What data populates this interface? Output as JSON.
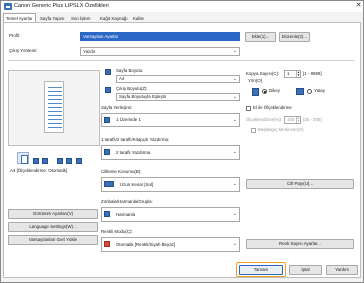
{
  "window": {
    "title": "Canon Generic Plus LIPSLX Özellikleri",
    "close_glyph": "✕"
  },
  "tabs": [
    {
      "label": "Temel Ayarlar"
    },
    {
      "label": "Sayfa Yapısı"
    },
    {
      "label": "Son İşlem"
    },
    {
      "label": "Kağıt Kaynağı"
    },
    {
      "label": "Kalite"
    }
  ],
  "profile": {
    "label": "Profil:",
    "value": "Varsayılan Ayarlar",
    "add_button": "Ekle(1)...",
    "edit_button": "Düzenle(2)..."
  },
  "output_method": {
    "label": "Çıkış Yöntemi:",
    "value": "Yazdır"
  },
  "page_size": {
    "label": "Sayfa Boyutu:",
    "value": "A4"
  },
  "output_size": {
    "label": "Çıkış Boyutu(Z):",
    "value": "Sayfa Boyutuyla Eşleştir"
  },
  "copies": {
    "label": "Kopya Sayısı(C):",
    "value": "1",
    "range": "[1 - 9999]"
  },
  "orientation": {
    "label": "Yön(O)",
    "portrait": "Dikey",
    "landscape": "Yatay",
    "selected": "portrait"
  },
  "page_layout": {
    "label": "Sayfa Yerleşimi:",
    "value": "1 Üzerinde 1"
  },
  "manual_scaling": {
    "label": "El ile Ölçeklendirme",
    "scale_label": "Ölçeklendirme(%):",
    "scale_value": "100",
    "scale_range": "[25 - 200]",
    "start_center": "Başlangıç Merkezde(S)"
  },
  "duplex": {
    "label": "1 taraflı/2 taraflı/Kitapçık Yazdırma:",
    "value": "2 taraflı Yazdırma"
  },
  "binding": {
    "label": "Ciltleme Konumu(B):",
    "value": "Uzun Kenar [Sol]",
    "gutter_button": "Cilt Payı(U)..."
  },
  "stapling": {
    "label": "Zımbala/Harmanla/Grupla:",
    "value": "Harmanla"
  },
  "color_mode": {
    "label": "Renkli Modu(C):",
    "value": "Otomatik [Renkli/Siyah Beyaz]",
    "color_count_button": "Renk Sayısı Ayarlar..."
  },
  "preview": {
    "caption": "A4 [Ölçeklendirme: Otomatik]"
  },
  "left_buttons": {
    "view": "Görünüm Ayarları(V)",
    "language": "Language Settings(W)...",
    "restore": "Varsayılanları Geri Yükle"
  },
  "footer": {
    "ok": "Tamam",
    "cancel": "İptal",
    "help": "Yardım"
  },
  "colors": {
    "accent": "#2b67c6",
    "focus": "#f0a020"
  }
}
